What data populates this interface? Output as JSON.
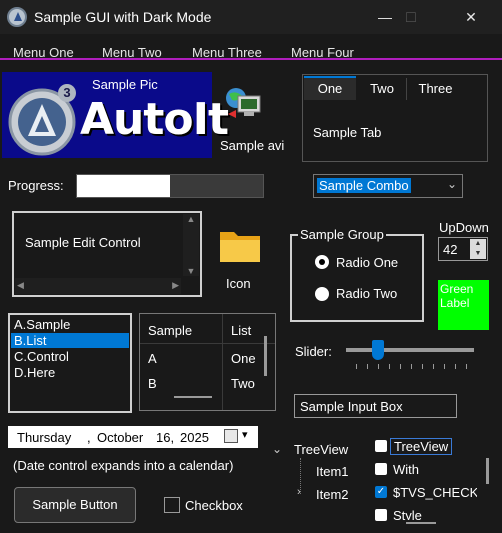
{
  "window": {
    "title": "Sample GUI with Dark Mode",
    "minimize_glyph": "—",
    "maximize_glyph": "□",
    "close_glyph": "✕"
  },
  "menu": [
    "Menu One",
    "Menu Two",
    "Menu Three",
    "Menu Four"
  ],
  "pic": {
    "caption": "Sample Pic",
    "logo_text": "AutoIt",
    "logo_badge": "3"
  },
  "avi": {
    "label": "Sample avi"
  },
  "tabs": {
    "items": [
      "One",
      "Two",
      "Three"
    ],
    "content": "Sample Tab"
  },
  "progress": {
    "label": "Progress:",
    "value": 0.5
  },
  "combo": {
    "value": "Sample Combo"
  },
  "edit": {
    "text": "Sample Edit Control"
  },
  "icon": {
    "label": "Icon"
  },
  "group": {
    "title": "Sample Group",
    "radio_one": "Radio One",
    "radio_two": "Radio Two"
  },
  "updown": {
    "label": "UpDown",
    "value": "42"
  },
  "green_label": {
    "text": "Green Label",
    "color": "#00ff00"
  },
  "listbox": {
    "items": [
      "A.Sample",
      "B.List",
      "C.Control",
      "D.Here"
    ],
    "selected": 1
  },
  "listview": {
    "columns": [
      "Sample",
      "List"
    ],
    "rows": [
      [
        "A",
        "One"
      ],
      [
        "B",
        "Two"
      ]
    ]
  },
  "slider": {
    "label": "Slider:",
    "value": 0.25
  },
  "input": {
    "value": "Sample Input Box"
  },
  "date": {
    "weekday": "Thursday",
    "sep": ",",
    "month": "October",
    "day": "16,",
    "year": "2025",
    "hint": "(Date control expands into a calendar)"
  },
  "treeview": {
    "root": "TreeView",
    "item1": "Item1",
    "item2": "Item2",
    "checks": [
      "TreeView",
      "With",
      "$TVS_CHECKBOXES",
      "Style"
    ]
  },
  "button": {
    "label": "Sample Button"
  },
  "checkbox": {
    "label": "Checkbox"
  },
  "colors": {
    "accent": "#0078d4",
    "menu_underline": "#b01ebd",
    "background": "#191919"
  }
}
